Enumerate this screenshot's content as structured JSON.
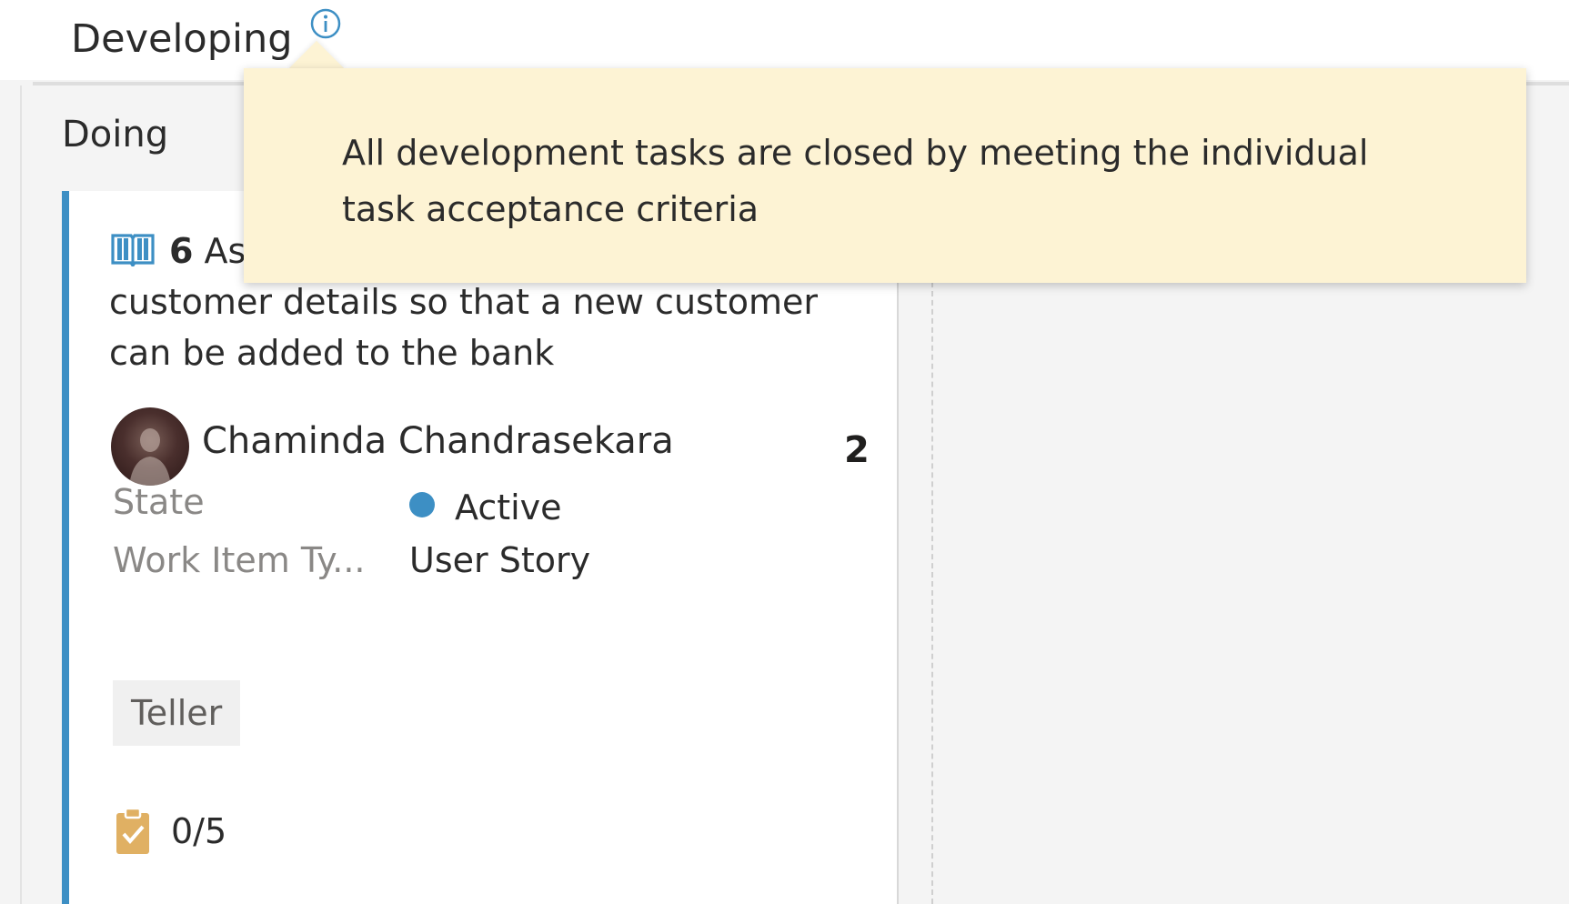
{
  "column": {
    "title": "Developing"
  },
  "sub_column": {
    "title": "Doing"
  },
  "tooltip": {
    "text": "All development tasks are closed by meeting the individual task acceptance criteria"
  },
  "card": {
    "id": "6",
    "title_start": "As",
    "title_continued": "customer details so that a new customer can be added to the bank",
    "assignee": "Chaminda Chandrasekara",
    "story_points": "2",
    "fields": [
      {
        "label": "State",
        "value": "Active"
      },
      {
        "label": "Work Item Ty...",
        "value": "User Story"
      }
    ],
    "tag": "Teller",
    "tasks": "0/5"
  },
  "colors": {
    "accent": "#3d8fc4",
    "tooltip_bg": "#fdf3d4",
    "task_icon": "#e0b063"
  },
  "icons": {
    "info": "info-icon",
    "story": "book-icon",
    "tasks": "clipboard-check-icon"
  }
}
